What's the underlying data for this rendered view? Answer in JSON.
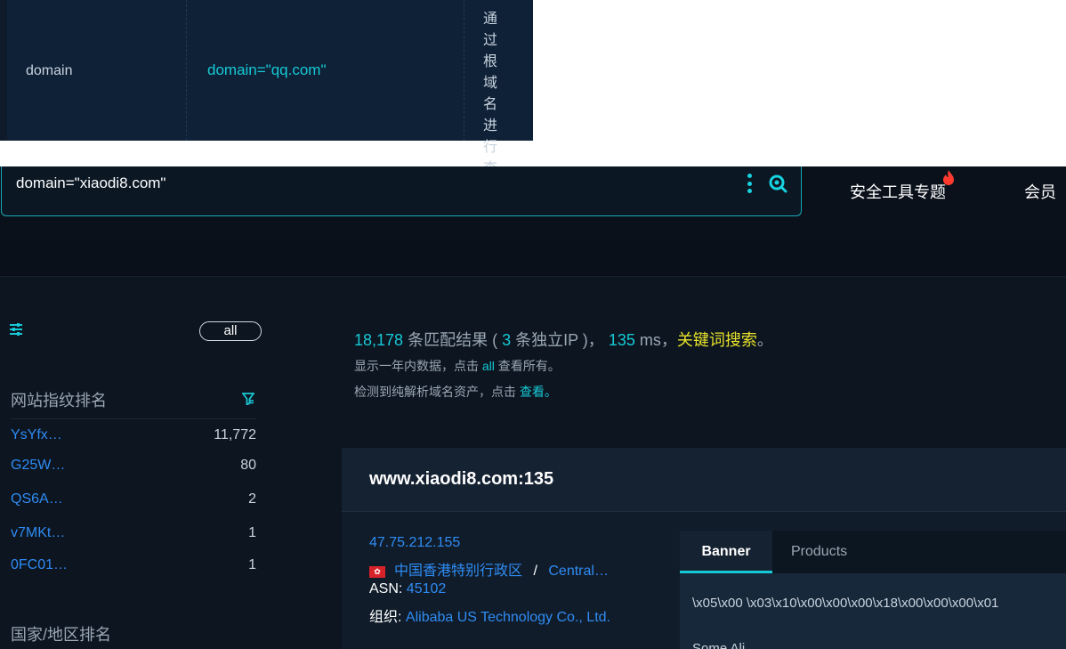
{
  "doc_table": {
    "field": "domain",
    "example": "domain=\"qq.com\"",
    "description": "通过根域名进行查询"
  },
  "search": {
    "query": "domain=\"xiaodi8.com\""
  },
  "nav": {
    "tools": "安全工具专题",
    "member": "会员"
  },
  "sidebar": {
    "all_label": "all",
    "fingerprint_title": "网站指纹排名",
    "fingerprints": [
      {
        "name": "YsYfx…",
        "count": "11,772"
      },
      {
        "name": "G25W…",
        "count": "80"
      },
      {
        "name": "QS6A…",
        "count": "2"
      },
      {
        "name": "v7MKt…",
        "count": "1"
      },
      {
        "name": "0FC01…",
        "count": "1"
      }
    ],
    "country_title": "国家/地区排名"
  },
  "summary": {
    "total": "18,178",
    "total_suffix": "条匹配结果 (",
    "unique_ip": "3",
    "unique_suffix": "条独立IP )，",
    "time": "135",
    "time_suffix": "ms，",
    "keyword_search": "关键词搜索",
    "end": "。",
    "line2_prefix": "显示一年内数据，点击",
    "line2_link": "all",
    "line2_suffix": "查看所有。",
    "line3_prefix": "检测到纯解析域名资产，点击",
    "line3_link": "查看。"
  },
  "result": {
    "title": "www.xiaodi8.com:135",
    "ip": "47.75.212.155",
    "region": "中国香港特别行政区",
    "separator": "/",
    "city": "Central…",
    "asn_label": "ASN:",
    "asn_value": "45102",
    "org_label": "组织:",
    "org_value": "Alibaba US Technology Co., Ltd.",
    "tabs": [
      "Banner",
      "Products"
    ],
    "banner_text": "\\x05\\x00 \\x03\\x10\\x00\\x00\\x00\\x18\\x00\\x00\\x00\\x01",
    "banner_more": "Some Ali..."
  },
  "colors": {
    "accent": "#17c9d6",
    "link": "#2f8cf3",
    "keyword": "#e8e22b",
    "background": "#0c1520"
  }
}
